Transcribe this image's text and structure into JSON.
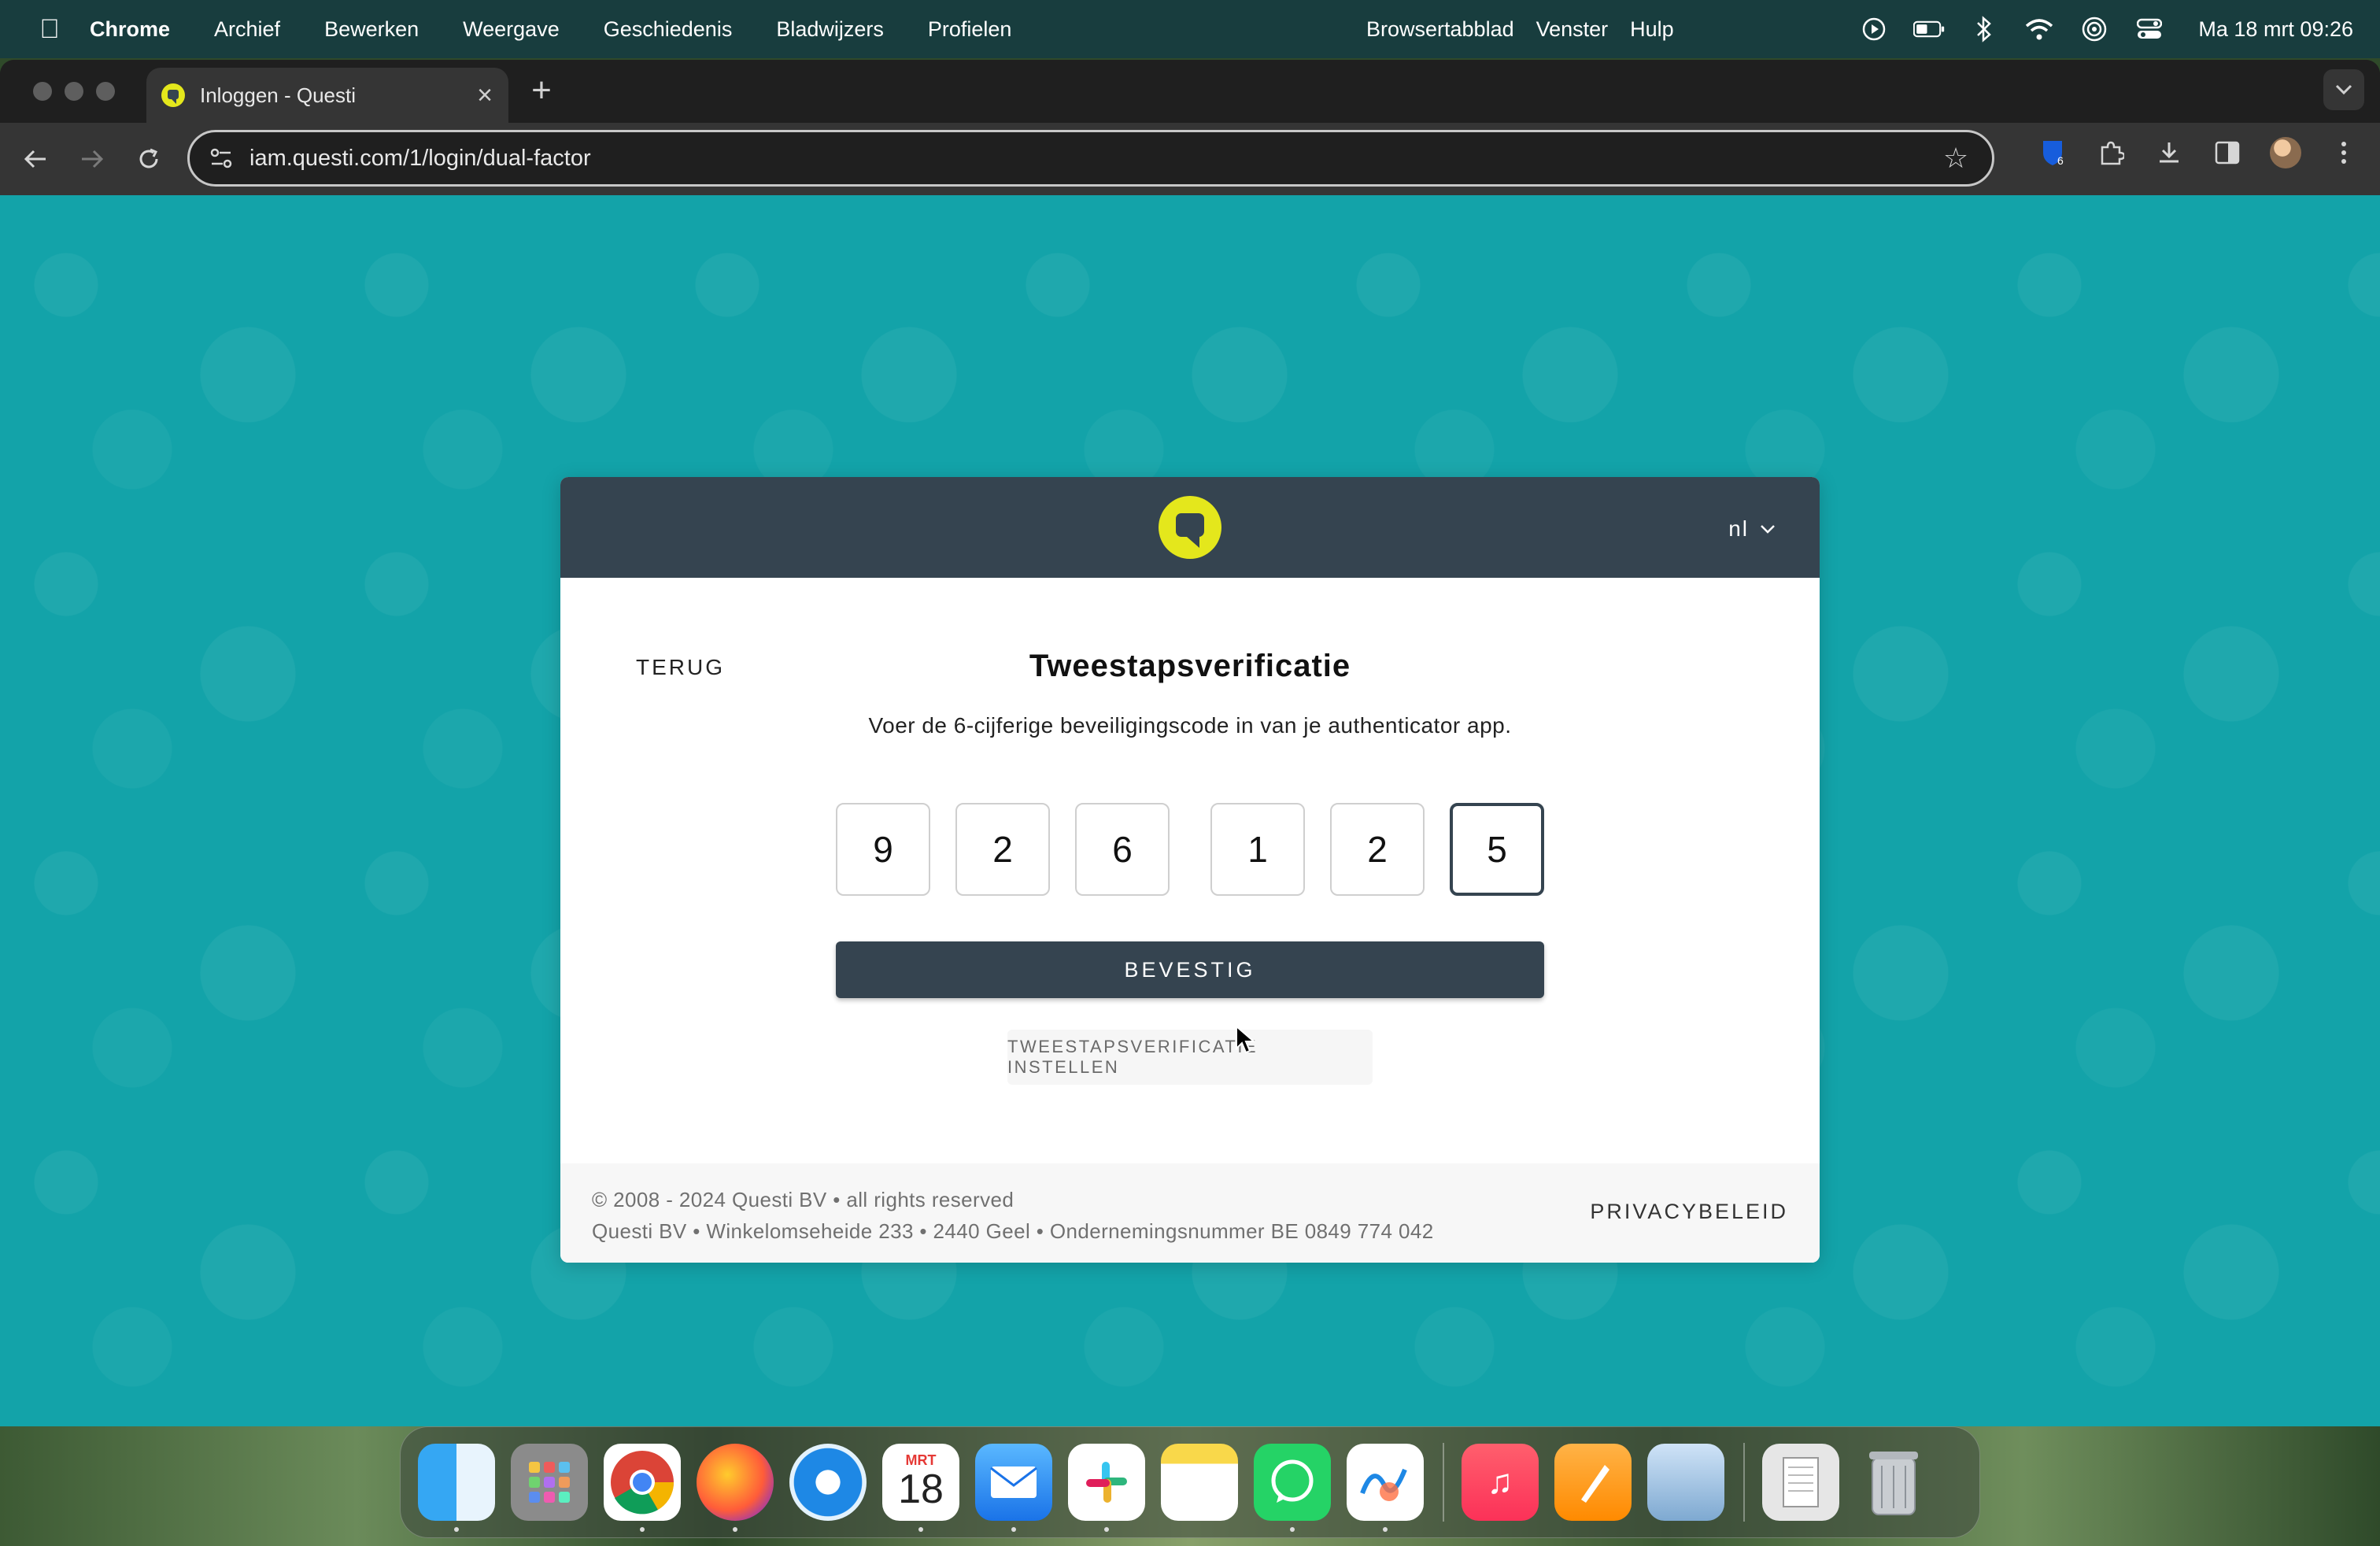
{
  "menubar": {
    "app_name": "Chrome",
    "menus": [
      "Archief",
      "Bewerken",
      "Weergave",
      "Geschiedenis",
      "Bladwijzers",
      "Profielen"
    ],
    "menus_right": [
      "Browsertabblad",
      "Venster",
      "Hulp"
    ],
    "clock": "Ma 18 mrt  09:26"
  },
  "browser": {
    "tab_title": "Inloggen - Questi",
    "url": "iam.questi.com/1/login/dual-factor",
    "extension_badge": "6"
  },
  "card": {
    "language": "nl",
    "back_label": "TERUG",
    "title": "Tweestapsverificatie",
    "subtitle": "Voer de 6-cijferige beveiligingscode in van je authenticator app.",
    "code_digits": [
      "9",
      "2",
      "6",
      "1",
      "2",
      "5"
    ],
    "confirm_label": "BEVESTIG",
    "setup_label": "TWEESTAPSVERIFICATIE INSTELLEN",
    "footer_line1": "© 2008 - 2024 Questi BV • all rights reserved",
    "footer_line2": "Questi BV • Winkelomseheide 233 • 2440 Geel • Ondernemingsnummer BE 0849 774 042",
    "privacy_label": "PRIVACYBELEID"
  },
  "dock": {
    "calendar_month": "MRT",
    "calendar_day": "18",
    "apps": [
      "finder",
      "launchpad",
      "chrome",
      "firefox",
      "safari",
      "calendar",
      "mail",
      "slack",
      "notes",
      "whatsapp",
      "freeform",
      "music",
      "pages",
      "preview",
      "downloads-stack",
      "trash"
    ]
  },
  "colors": {
    "page_bg": "#13a3a9",
    "card_header": "#354450",
    "logo_yellow": "#e4e71c",
    "menubar": "#183d3e"
  }
}
